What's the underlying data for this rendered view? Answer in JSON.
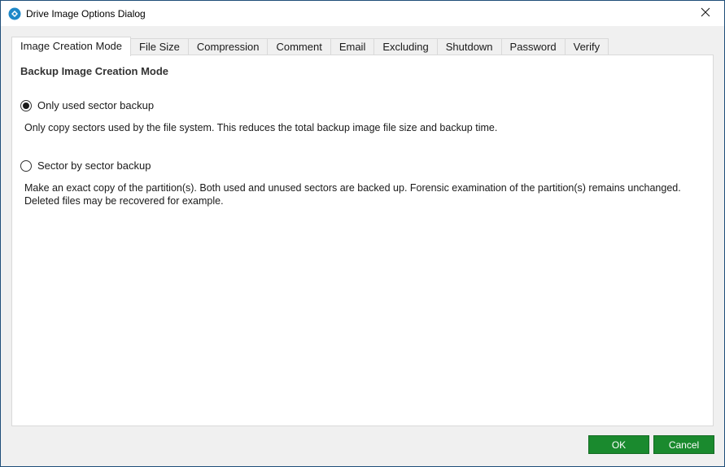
{
  "window": {
    "title": "Drive Image Options Dialog"
  },
  "tabs": [
    {
      "label": "Image Creation Mode",
      "active": true
    },
    {
      "label": "File Size",
      "active": false
    },
    {
      "label": "Compression",
      "active": false
    },
    {
      "label": "Comment",
      "active": false
    },
    {
      "label": "Email",
      "active": false
    },
    {
      "label": "Excluding",
      "active": false
    },
    {
      "label": "Shutdown",
      "active": false
    },
    {
      "label": "Password",
      "active": false
    },
    {
      "label": "Verify",
      "active": false
    }
  ],
  "panel": {
    "heading": "Backup Image Creation Mode",
    "options": [
      {
        "label": "Only used sector backup",
        "selected": true,
        "description": "Only copy sectors used by the file system. This reduces the total backup image file size and backup time."
      },
      {
        "label": "Sector by sector backup",
        "selected": false,
        "description": "Make an exact copy of the partition(s). Both used and unused sectors are backed up. Forensic examination of the partition(s) remains unchanged. Deleted files may be recovered for example."
      }
    ]
  },
  "buttons": {
    "ok_label": "OK",
    "cancel_label": "Cancel"
  },
  "colors": {
    "button_green": "#1a8a2e",
    "window_border": "#1f4e79",
    "app_icon_blue": "#1e88c8"
  },
  "icons": {
    "app": "app-logo-icon",
    "close": "close-icon"
  }
}
